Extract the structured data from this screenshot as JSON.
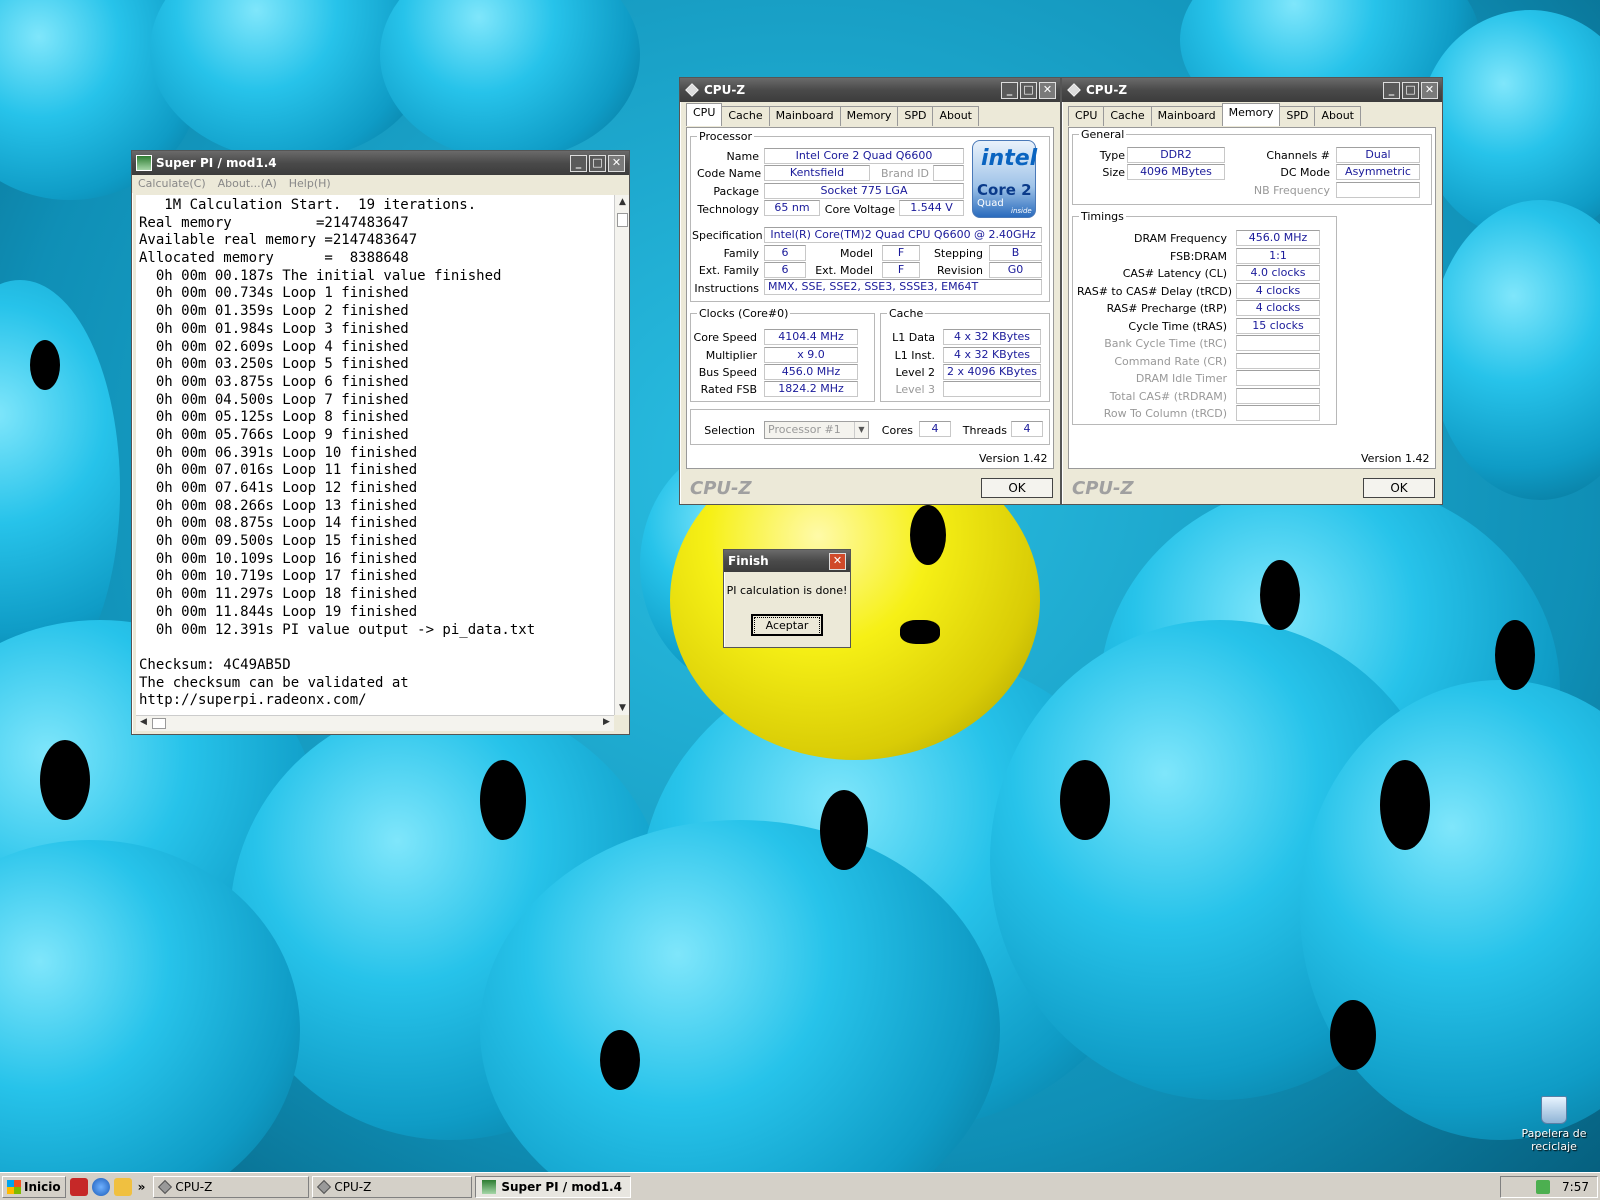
{
  "desktop": {
    "recycle_bin_label": "Papelera de reciclaje"
  },
  "superpi": {
    "title": "Super PI / mod1.4",
    "menu": [
      "Calculate(C)",
      "About...(A)",
      "Help(H)"
    ],
    "output_lines": [
      "   1M Calculation Start.  19 iterations.",
      "Real memory          =2147483647",
      "Available real memory =2147483647",
      "Allocated memory      =  8388648",
      "  0h 00m 00.187s The initial value finished",
      "  0h 00m 00.734s Loop 1 finished",
      "  0h 00m 01.359s Loop 2 finished",
      "  0h 00m 01.984s Loop 3 finished",
      "  0h 00m 02.609s Loop 4 finished",
      "  0h 00m 03.250s Loop 5 finished",
      "  0h 00m 03.875s Loop 6 finished",
      "  0h 00m 04.500s Loop 7 finished",
      "  0h 00m 05.125s Loop 8 finished",
      "  0h 00m 05.766s Loop 9 finished",
      "  0h 00m 06.391s Loop 10 finished",
      "  0h 00m 07.016s Loop 11 finished",
      "  0h 00m 07.641s Loop 12 finished",
      "  0h 00m 08.266s Loop 13 finished",
      "  0h 00m 08.875s Loop 14 finished",
      "  0h 00m 09.500s Loop 15 finished",
      "  0h 00m 10.109s Loop 16 finished",
      "  0h 00m 10.719s Loop 17 finished",
      "  0h 00m 11.297s Loop 18 finished",
      "  0h 00m 11.844s Loop 19 finished",
      "  0h 00m 12.391s PI value output -> pi_data.txt",
      "",
      "Checksum: 4C49AB5D",
      "The checksum can be validated at",
      "http://superpi.radeonx.com/"
    ]
  },
  "cpuz_cpu": {
    "title": "CPU-Z",
    "tabs": [
      "CPU",
      "Cache",
      "Mainboard",
      "Memory",
      "SPD",
      "About"
    ],
    "active_tab": "CPU",
    "processor_legend": "Processor",
    "name_label": "Name",
    "name": "Intel Core 2 Quad Q6600",
    "codename_label": "Code Name",
    "codename": "Kentsfield",
    "brandid_label": "Brand ID",
    "brandid": "",
    "package_label": "Package",
    "package": "Socket 775 LGA",
    "technology_label": "Technology",
    "technology": "65 nm",
    "corevoltage_label": "Core Voltage",
    "corevoltage": "1.544 V",
    "spec_label": "Specification",
    "spec": "Intel(R) Core(TM)2 Quad CPU    Q6600  @ 2.40GHz",
    "family_label": "Family",
    "family": "6",
    "model_label": "Model",
    "model": "F",
    "stepping_label": "Stepping",
    "stepping": "B",
    "extfamily_label": "Ext. Family",
    "extfamily": "6",
    "extmodel_label": "Ext. Model",
    "extmodel": "F",
    "revision_label": "Revision",
    "revision": "G0",
    "instructions_label": "Instructions",
    "instructions": "MMX, SSE, SSE2, SSE3, SSSE3, EM64T",
    "clocks_legend": "Clocks (Core#0)",
    "corespeed_label": "Core Speed",
    "corespeed": "4104.4 MHz",
    "multiplier_label": "Multiplier",
    "multiplier": "x 9.0",
    "busspeed_label": "Bus Speed",
    "busspeed": "456.0 MHz",
    "ratedfsb_label": "Rated FSB",
    "ratedfsb": "1824.2 MHz",
    "cache_legend": "Cache",
    "l1data_label": "L1 Data",
    "l1data": "4 x 32 KBytes",
    "l1inst_label": "L1 Inst.",
    "l1inst": "4 x 32 KBytes",
    "level2_label": "Level 2",
    "level2": "2 x 4096 KBytes",
    "level3_label": "Level 3",
    "level3": "",
    "selection_label": "Selection",
    "selection": "Processor #1",
    "cores_label": "Cores",
    "cores": "4",
    "threads_label": "Threads",
    "threads": "4",
    "version": "Version 1.42",
    "brand": "CPU-Z",
    "ok_label": "OK",
    "logo_intel": "intel",
    "logo_core2": "Core 2",
    "logo_quad": "Quad",
    "logo_inside": "inside"
  },
  "cpuz_mem": {
    "title": "CPU-Z",
    "tabs": [
      "CPU",
      "Cache",
      "Mainboard",
      "Memory",
      "SPD",
      "About"
    ],
    "active_tab": "Memory",
    "general_legend": "General",
    "type_label": "Type",
    "type": "DDR2",
    "size_label": "Size",
    "size": "4096 MBytes",
    "channels_label": "Channels #",
    "channels": "Dual",
    "dcmode_label": "DC Mode",
    "dcmode": "Asymmetric",
    "nbfreq_label": "NB Frequency",
    "nbfreq": "",
    "timings_legend": "Timings",
    "timings": [
      {
        "label": "DRAM Frequency",
        "value": "456.0 MHz",
        "dim": false
      },
      {
        "label": "FSB:DRAM",
        "value": "1:1",
        "dim": false
      },
      {
        "label": "CAS# Latency (CL)",
        "value": "4.0 clocks",
        "dim": false
      },
      {
        "label": "RAS# to CAS# Delay (tRCD)",
        "value": "4 clocks",
        "dim": false
      },
      {
        "label": "RAS# Precharge (tRP)",
        "value": "4 clocks",
        "dim": false
      },
      {
        "label": "Cycle Time (tRAS)",
        "value": "15 clocks",
        "dim": false
      },
      {
        "label": "Bank Cycle Time (tRC)",
        "value": "",
        "dim": true
      },
      {
        "label": "Command Rate (CR)",
        "value": "",
        "dim": true
      },
      {
        "label": "DRAM Idle Timer",
        "value": "",
        "dim": true
      },
      {
        "label": "Total CAS# (tRDRAM)",
        "value": "",
        "dim": true
      },
      {
        "label": "Row To Column (tRCD)",
        "value": "",
        "dim": true
      }
    ],
    "version": "Version 1.42",
    "brand": "CPU-Z",
    "ok_label": "OK"
  },
  "finish_dialog": {
    "title": "Finish",
    "message": "PI calculation is done!",
    "button_label": "Aceptar"
  },
  "taskbar": {
    "start_label": "Inicio",
    "items": [
      {
        "label": "CPU-Z",
        "active": false
      },
      {
        "label": "CPU-Z",
        "active": false
      },
      {
        "label": "Super PI / mod1.4",
        "active": true
      }
    ],
    "overflow_label": "»",
    "clock": "7:57"
  },
  "colors": {
    "value_text": "#1a1a9a",
    "titlebar": "#4a4a4a",
    "desktop_blue": "#27c3ea",
    "desktop_yellow": "#f6f016"
  }
}
